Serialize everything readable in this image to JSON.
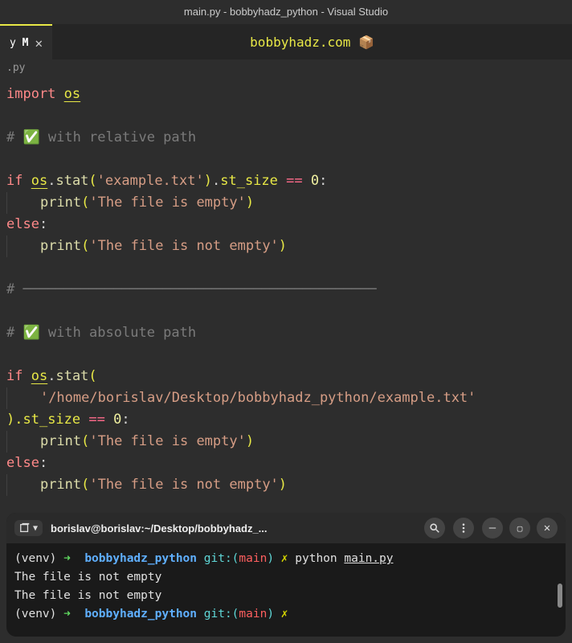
{
  "titleBar": "main.py - bobbyhadz_python - Visual Studio",
  "tab": {
    "label": "y",
    "modified": "M",
    "close": "✕"
  },
  "centerBanner": "bobbyhadz.com 📦",
  "breadcrumb": ".py",
  "code": {
    "l1_import": "import",
    "l1_os": "os",
    "l3_comment": "# ✅ with relative path",
    "l5_if": "if",
    "l5_os": "os",
    "l5_dot1": ".",
    "l5_stat": "stat",
    "l5_p1": "(",
    "l5_str": "'example.txt'",
    "l5_p2": ")",
    "l5_dot2": ".",
    "l5_size": "st_size",
    "l5_eq": " == ",
    "l5_zero": "0",
    "l5_colon": ":",
    "l6_print": "print",
    "l6_str": "'The file is empty'",
    "l7_else": "else",
    "l8_print": "print",
    "l8_str": "'The file is not empty'",
    "l10_sep": "# ───────────────────────────────────────────",
    "l12_comment": "# ✅ with absolute path",
    "l14_if": "if",
    "l14_os": "os",
    "l14_stat": "stat",
    "l15_str": "'/home/borislav/Desktop/bobbyhadz_python/example.txt'",
    "l16_close": ").",
    "l16_size": "st_size",
    "l16_eq": " == ",
    "l16_zero": "0",
    "l17_print": "print",
    "l17_str": "'The file is empty'",
    "l18_else": "else",
    "l19_print": "print",
    "l19_str": "'The file is not empty'"
  },
  "terminal": {
    "title": "borislav@borislav:~/Desktop/bobbyhadz_...",
    "line1_venv": "(venv)",
    "line1_arrow": "➜",
    "line1_dir": "bobbyhadz_python",
    "line1_git": "git:(",
    "line1_branch": "main",
    "line1_gitclose": ")",
    "line1_x": "✗",
    "line1_cmd": "python ",
    "line1_file": "main.py",
    "line2": "The file is not empty",
    "line3": "The file is not empty",
    "line4_venv": "(venv)",
    "line4_arrow": "➜",
    "line4_dir": "bobbyhadz_python",
    "line4_git": "git:(",
    "line4_branch": "main",
    "line4_gitclose": ")",
    "line4_x": "✗"
  }
}
